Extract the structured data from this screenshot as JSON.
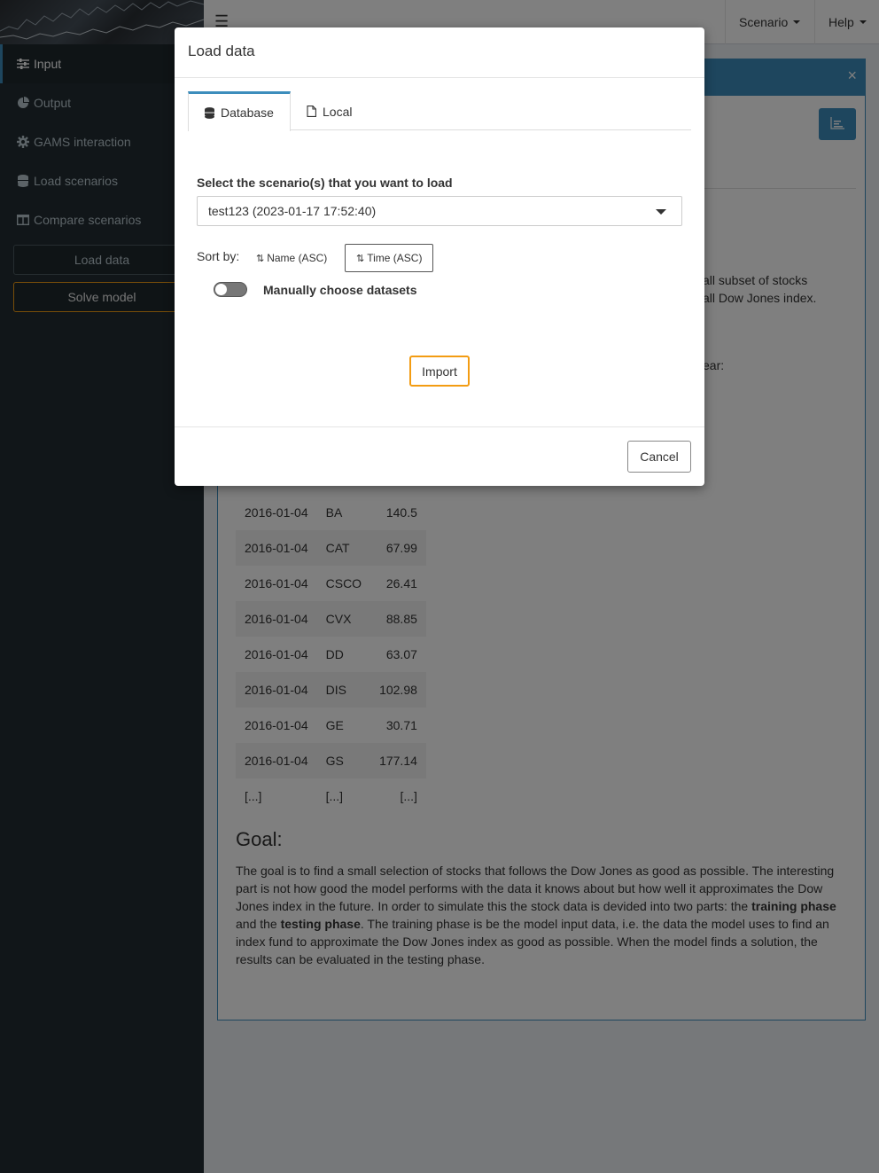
{
  "sidebar": {
    "items": [
      {
        "label": "Input",
        "icon": "sliders-icon"
      },
      {
        "label": "Output",
        "icon": "pie-chart-icon"
      },
      {
        "label": "GAMS interaction",
        "icon": "gear-icon"
      },
      {
        "label": "Load scenarios",
        "icon": "database-icon"
      },
      {
        "label": "Compare scenarios",
        "icon": "columns-icon"
      }
    ],
    "load_data_label": "Load data",
    "solve_model_label": "Solve model"
  },
  "header": {
    "menu_icon": "☰",
    "scenario_label": "Scenario",
    "help_label": "Help"
  },
  "content": {
    "alert_close": "×",
    "intro_line1": "all subset of stocks",
    "intro_line2": "all Dow Jones index.",
    "intro_line3": "ear:",
    "table": [
      {
        "date": "2016-01-04",
        "symbol": "BA",
        "value": "140.5"
      },
      {
        "date": "2016-01-04",
        "symbol": "CAT",
        "value": "67.99"
      },
      {
        "date": "2016-01-04",
        "symbol": "CSCO",
        "value": "26.41"
      },
      {
        "date": "2016-01-04",
        "symbol": "CVX",
        "value": "88.85"
      },
      {
        "date": "2016-01-04",
        "symbol": "DD",
        "value": "63.07"
      },
      {
        "date": "2016-01-04",
        "symbol": "DIS",
        "value": "102.98"
      },
      {
        "date": "2016-01-04",
        "symbol": "GE",
        "value": "30.71"
      },
      {
        "date": "2016-01-04",
        "symbol": "GS",
        "value": "177.14"
      },
      {
        "date": "[...]",
        "symbol": "[...]",
        "value": "[...]"
      }
    ],
    "goal_heading": "Goal:",
    "goal_p1": "The goal is to find a small selection of stocks that follows the Dow Jones as good as possible. The interesting part is not how good the model performs with the data it knows about but how well it approximates the Dow Jones index in the future. In order to simulate this the stock data is devided into two parts: the ",
    "goal_b1": "training phase",
    "goal_p2": " and the ",
    "goal_b2": "testing phase",
    "goal_p3": ". The training phase is be the model input data, i.e. the data the model uses to find an index fund to approximate the Dow Jones index as good as possible. When the model finds a solution, the results can be evaluated in the testing phase."
  },
  "modal": {
    "title": "Load data",
    "tabs": [
      {
        "label": "Database",
        "icon": "database-icon",
        "active": true
      },
      {
        "label": "Local",
        "icon": "file-icon",
        "active": false
      }
    ],
    "select_label": "Select the scenario(s) that you want to load",
    "selected_scenario": "test123 (2023-01-17 17:52:40)",
    "sort_label": "Sort by:",
    "sort_name_label": "Name (ASC)",
    "sort_time_label": "Time (ASC)",
    "sort_icon": "⇅",
    "toggle_label": "Manually choose datasets",
    "toggle_on": false,
    "import_label": "Import",
    "cancel_label": "Cancel"
  },
  "colors": {
    "primary": "#3c8dbc",
    "accent_orange": "#f39c12",
    "sidebar_bg": "#222d32"
  }
}
